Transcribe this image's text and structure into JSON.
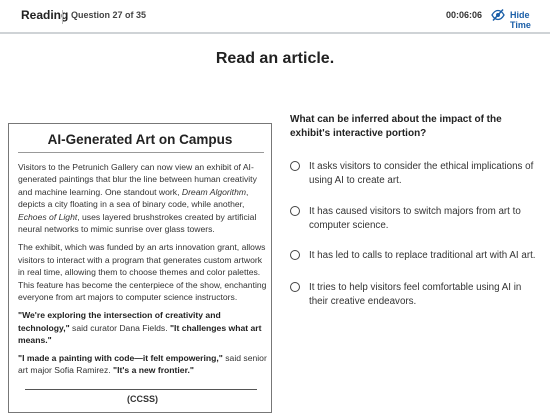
{
  "header": {
    "section": "Reading",
    "question_counter": "Question 27 of 35",
    "timer": "00:06:06",
    "hide_time_label": "Hide Time",
    "timer_icon": "eye-slash-icon"
  },
  "prompt": {
    "title": "Read an article."
  },
  "article": {
    "title": "AI-Generated Art on Campus",
    "p1_pre": "Visitors to the Petrunich Gallery can now view an exhibit of AI-generated paintings that blur the line between human creativity and machine learning. One standout work, ",
    "p1_em1": "Dream Algorithm",
    "p1_mid": ", depicts a city floating in a sea of binary code, while another, ",
    "p1_em2": "Echoes of Light",
    "p1_post": ", uses layered brushstrokes created by artificial neural networks to mimic sunrise over glass towers.",
    "p2": "The exhibit, which was funded by an arts innovation grant, allows visitors to interact with a program that generates custom artwork in real time, allowing them to choose themes and color palettes. This feature has become the centerpiece of the show, enchanting everyone from art majors to computer science instructors.",
    "q1_bold": "\"We're exploring the intersection of creativity and technology,\"",
    "q1_mid": " said curator Dana Fields. ",
    "q1_bold2": "\"It challenges what art means.\"",
    "q2_bold": "\"I made a painting with code—it felt empowering,\"",
    "q2_mid": " said senior art major Sofia Ramirez. ",
    "q2_bold2": "\"It's a new frontier.\"",
    "cut_text": "(CCSS)"
  },
  "question": {
    "text": "What can be inferred about the impact of the exhibit's interactive portion?",
    "options": [
      {
        "label": "It asks visitors to consider the ethical implications of using AI to create art."
      },
      {
        "label": "It has caused visitors to switch majors from art to computer science."
      },
      {
        "label": "It has led to calls to replace traditional art with AI art."
      },
      {
        "label": "It tries to help visitors feel comfortable using AI in their creative endeavors."
      }
    ]
  },
  "colors": {
    "accent": "#1b5fa8",
    "border": "#cfd3d6"
  }
}
